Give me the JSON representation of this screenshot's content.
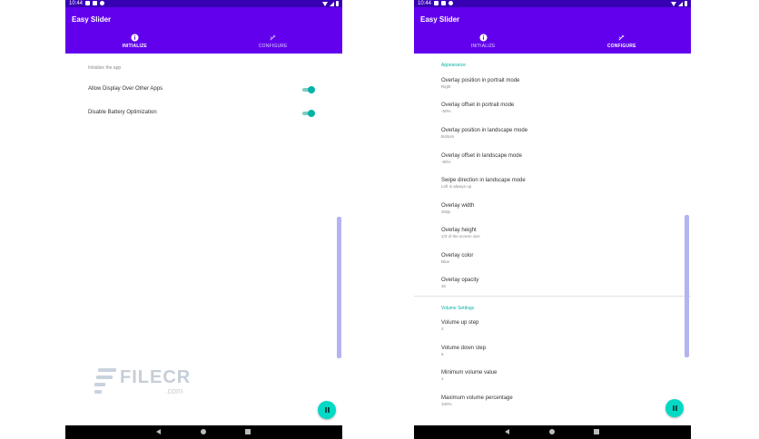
{
  "status_bar": {
    "time": "10:44"
  },
  "app": {
    "title": "Easy Slider"
  },
  "tabs": [
    {
      "label": "INITIALIZE",
      "icon": "info-icon"
    },
    {
      "label": "CONFIGURE",
      "icon": "tools-icon"
    }
  ],
  "initialize": {
    "caption": "Initialize the app",
    "toggles": [
      {
        "label": "Allow Display Over Other Apps",
        "checked": true
      },
      {
        "label": "Disable Battery Optimization",
        "checked": true
      }
    ]
  },
  "configure": {
    "appearance": {
      "header": "Appearance",
      "items": [
        {
          "title": "Overlay position in portrait mode",
          "summary": "Right"
        },
        {
          "title": "Overlay offset in portrait mode",
          "summary": "-50%"
        },
        {
          "title": "Overlay position in landscape mode",
          "summary": "Bottom"
        },
        {
          "title": "Overlay offset in landscape mode",
          "summary": "-90%"
        },
        {
          "title": "Swipe direction in landscape mode",
          "summary": "Left is always up"
        },
        {
          "title": "Overlay width",
          "summary": "30dp"
        },
        {
          "title": "Overlay height",
          "summary": "1/3 of the screen size"
        },
        {
          "title": "Overlay color",
          "summary": "Blue"
        },
        {
          "title": "Overlay opacity",
          "summary": "30"
        }
      ]
    },
    "volume": {
      "header": "Volume Settings",
      "items": [
        {
          "title": "Volume up step",
          "summary": "3"
        },
        {
          "title": "Volume down step",
          "summary": "6"
        },
        {
          "title": "Minimum volume value",
          "summary": "1"
        },
        {
          "title": "Maximum volume percentage",
          "summary": "100%"
        }
      ]
    }
  },
  "watermark": {
    "brand": "FILECR",
    "suffix": ".com"
  },
  "colors": {
    "app_bar": "#6200ee",
    "status_bar": "#3700b3",
    "accent": "#03dac5",
    "switch_on": "#03b4a6",
    "scrollbar": "#b3b3f2"
  },
  "icons": {
    "fab": "pause-icon",
    "nav": [
      "back-icon",
      "home-icon",
      "recents-icon"
    ]
  }
}
